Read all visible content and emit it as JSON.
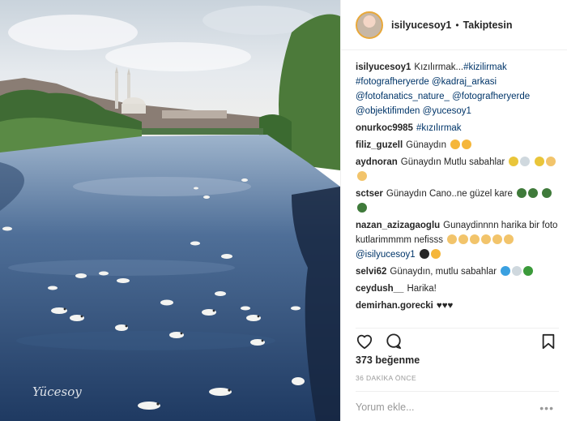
{
  "photo": {
    "watermark": "Yücesoy",
    "scene": "river-with-ducks-and-mosque"
  },
  "header": {
    "username": "isilyucesoy1",
    "separator": "•",
    "follow_label": "Takiptesin"
  },
  "comments": [
    {
      "user": "isilyucesoy1",
      "text": "Kızılırmak...",
      "tags": [
        "#kizilirmak",
        "#fotografheryerde",
        "@kadraj_arkasi",
        "@fotofanatics_nature_",
        "@fotografheryerde",
        "@objektifimden",
        "@yucesoy1"
      ]
    },
    {
      "user": "onurkoc9985",
      "text": "",
      "tags": [
        "#kızılırmak"
      ]
    },
    {
      "user": "filiz_guzell",
      "text": "Günaydın",
      "emojis": [
        "heart-eyes",
        "smile"
      ]
    },
    {
      "user": "aydnoran",
      "text": "Günaydın Mutlu sabahlar",
      "emojis": [
        "flower",
        "coffee",
        "flower",
        "hand",
        "hand"
      ]
    },
    {
      "user": "sctser",
      "text": "Günaydın Cano..ne güzel kare",
      "emojis": [
        "sunglasses",
        "sunglasses",
        "sunglasses",
        "sunglasses"
      ]
    },
    {
      "user": "nazan_azizagaoglu",
      "text": "Gunaydinnnn harika bir foto kutlarimmmm nefisss",
      "tags": [
        "@isilyucesoy1"
      ],
      "emojis": [
        "clap",
        "clap",
        "thumbs",
        "thumbs",
        "hand",
        "hand",
        "heart",
        "smile"
      ]
    },
    {
      "user": "selvi62",
      "text": "Günaydın, mutlu sabahlar",
      "emojis": [
        "blue-heart",
        "coffee",
        "clover"
      ]
    },
    {
      "user": "ceydush__",
      "text": "Harika!"
    },
    {
      "user": "demirhan.gorecki",
      "text": "♥♥♥"
    }
  ],
  "actions": {
    "like_icon": "heart-icon",
    "comment_icon": "comment-icon",
    "save_icon": "bookmark-icon"
  },
  "likes_text": "373 beğenme",
  "time_text": "36 DAKİKA ÖNCE",
  "add_comment_placeholder": "Yorum ekle...",
  "menu_label": "•••",
  "colors": {
    "text": "#262626",
    "tag": "#003569",
    "muted": "#999999",
    "border": "#efefef"
  }
}
